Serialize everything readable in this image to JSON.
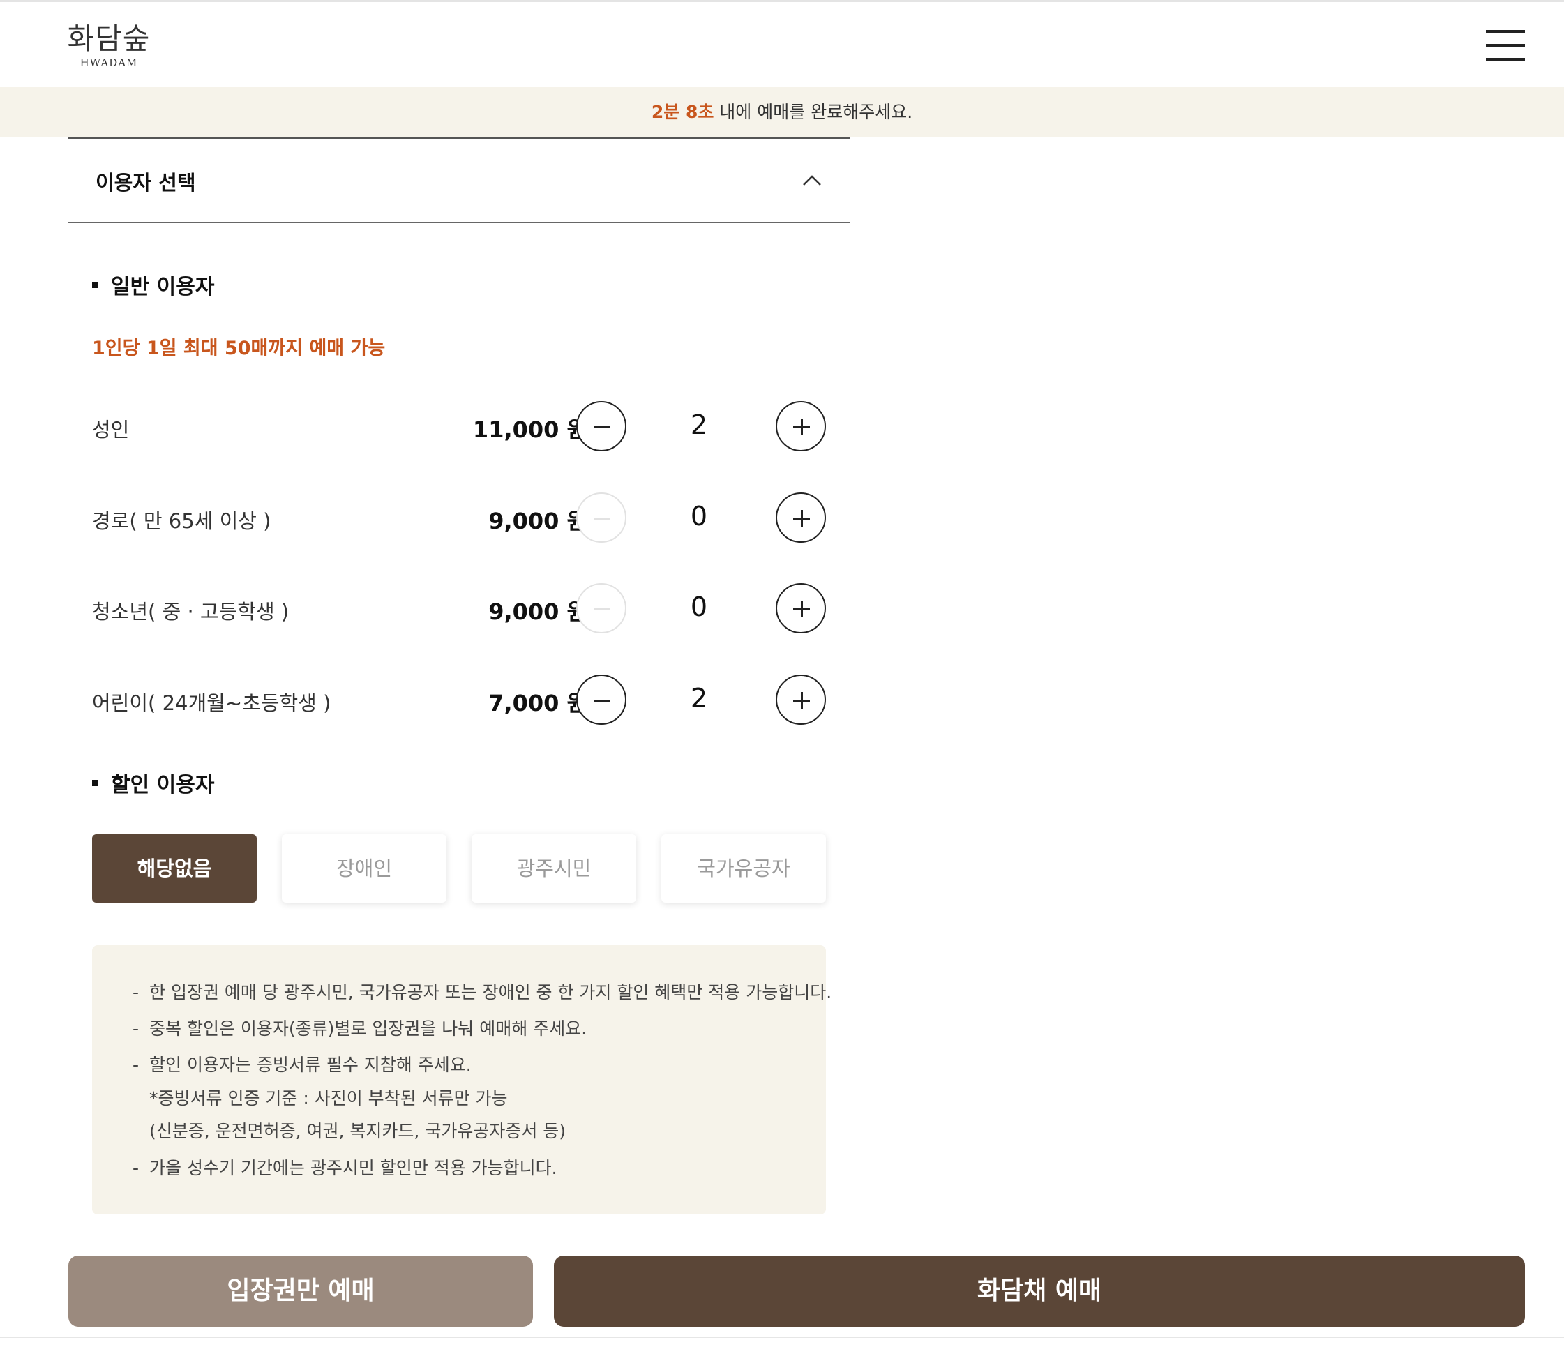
{
  "header": {
    "logo_main": "화담숲",
    "logo_sub": "HWADAM",
    "menu_icon": "hamburger-menu-icon"
  },
  "timer": {
    "remaining": "2분 8초",
    "message": "내에 예매를 완료해주세요."
  },
  "section": {
    "title": "이용자 선택",
    "toggle_icon": "chevron-up-icon"
  },
  "general": {
    "title": "일반 이용자",
    "limit_note": "1인당 1일 최대 50매까지 예매 가능",
    "rows": [
      {
        "label": "성인",
        "price": "11,000 원",
        "qty": "2",
        "minus_enabled": true
      },
      {
        "label": "경로( 만 65세 이상 )",
        "price": "9,000 원",
        "qty": "0",
        "minus_enabled": false
      },
      {
        "label": "청소년( 중 · 고등학생 )",
        "price": "9,000 원",
        "qty": "0",
        "minus_enabled": false
      },
      {
        "label": "어린이( 24개월~초등학생 )",
        "price": "7,000 원",
        "qty": "2",
        "minus_enabled": true
      }
    ]
  },
  "discount": {
    "title": "할인 이용자",
    "options": [
      "해당없음",
      "장애인",
      "광주시민",
      "국가유공자"
    ],
    "selected": "해당없음"
  },
  "notice": {
    "lines": [
      "한 입장권 예매 당 광주시민, 국가유공자 또는 장애인 중 한 가지 할인 혜택만 적용 가능합니다.",
      "중복 할인은 이용자(종류)별로 입장권을 나눠 예매해 주세요.",
      "할인 이용자는 증빙서류 필수 지참해 주세요.",
      "가을 성수기 기간에는 광주시민 할인만 적용 가능합니다."
    ],
    "sub_lines": [
      "*증빙서류 인증 기준 : 사진이 부착된 서류만 가능",
      "(신분증, 운전면허증, 여권, 복지카드, 국가유공자증서 등)"
    ]
  },
  "buttons": {
    "ticket_only": "입장권만 예매",
    "hwadam_reserve": "화담채 예매"
  },
  "colors": {
    "accent_orange": "#c8561d",
    "brand_brown": "#5b4637",
    "muted_brown": "#9b8a7e",
    "banner_bg": "#f6f3ea"
  }
}
